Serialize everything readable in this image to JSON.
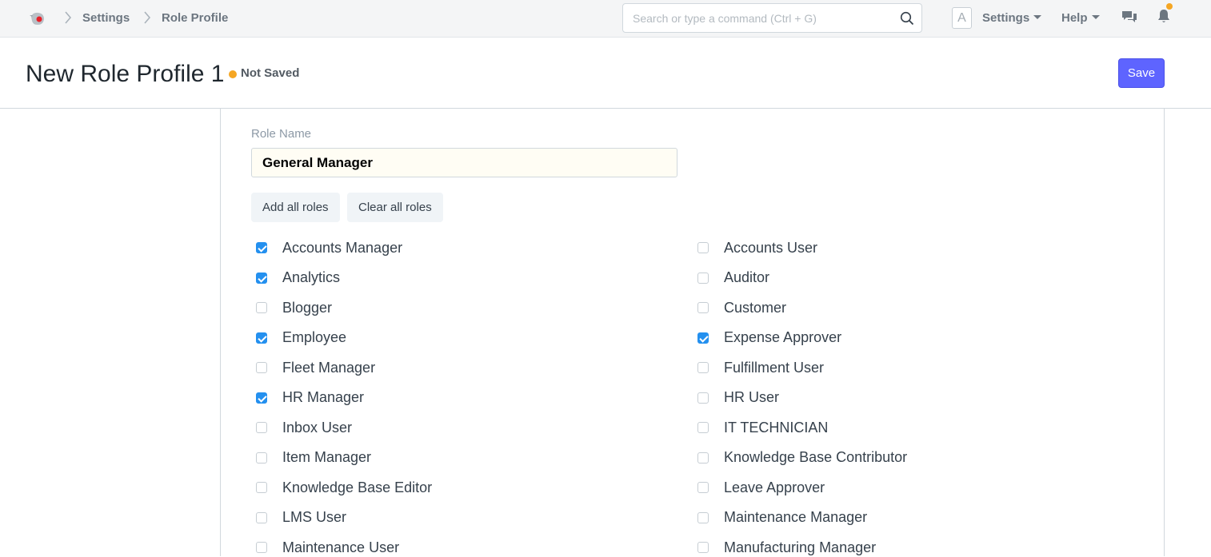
{
  "navbar": {
    "breadcrumbs": [
      "Settings",
      "Role Profile"
    ],
    "search_placeholder": "Search or type a command (Ctrl + G)",
    "avatar_letter": "A",
    "settings_label": "Settings",
    "help_label": "Help",
    "accent_color": "#f5a623"
  },
  "page": {
    "title": "New Role Profile 1",
    "status": "Not Saved",
    "save_label": "Save",
    "primary_color": "#5e64ff"
  },
  "form": {
    "role_name_label": "Role Name",
    "role_name_value": "General Manager",
    "add_all_label": "Add all roles",
    "clear_all_label": "Clear all roles",
    "checkbox_color": "#2490ef"
  },
  "roles": {
    "left": [
      {
        "label": "Accounts Manager",
        "checked": true
      },
      {
        "label": "Analytics",
        "checked": true
      },
      {
        "label": "Blogger",
        "checked": false
      },
      {
        "label": "Employee",
        "checked": true
      },
      {
        "label": "Fleet Manager",
        "checked": false
      },
      {
        "label": "HR Manager",
        "checked": true
      },
      {
        "label": "Inbox User",
        "checked": false
      },
      {
        "label": "Item Manager",
        "checked": false
      },
      {
        "label": "Knowledge Base Editor",
        "checked": false
      },
      {
        "label": "LMS User",
        "checked": false
      },
      {
        "label": "Maintenance User",
        "checked": false
      }
    ],
    "right": [
      {
        "label": "Accounts User",
        "checked": false
      },
      {
        "label": "Auditor",
        "checked": false
      },
      {
        "label": "Customer",
        "checked": false
      },
      {
        "label": "Expense Approver",
        "checked": true
      },
      {
        "label": "Fulfillment User",
        "checked": false
      },
      {
        "label": "HR User",
        "checked": false
      },
      {
        "label": "IT TECHNICIAN",
        "checked": false
      },
      {
        "label": "Knowledge Base Contributor",
        "checked": false
      },
      {
        "label": "Leave Approver",
        "checked": false
      },
      {
        "label": "Maintenance Manager",
        "checked": false
      },
      {
        "label": "Manufacturing Manager",
        "checked": false
      }
    ]
  }
}
